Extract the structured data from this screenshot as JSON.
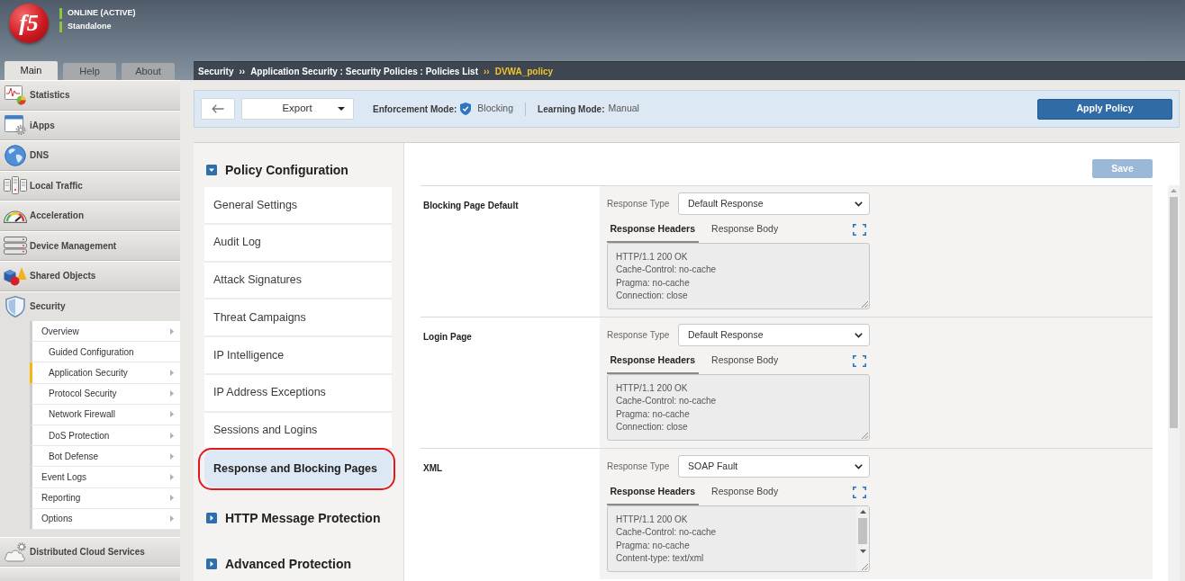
{
  "header": {
    "logo": "f5",
    "status": [
      "ONLINE (ACTIVE)",
      "Standalone"
    ]
  },
  "top_tabs": [
    {
      "label": "Main",
      "selected": true
    },
    {
      "label": "Help",
      "selected": false
    },
    {
      "label": "About",
      "selected": false
    }
  ],
  "breadcrumb": [
    {
      "label": "Security",
      "current": false
    },
    {
      "separator": "››",
      "label": "Application Security : Security Policies : Policies List",
      "current": false
    },
    {
      "separator": "››",
      "label": "DVWA_policy",
      "current": true
    }
  ],
  "sidebar": {
    "items": [
      {
        "label": "Statistics",
        "expanded": false
      },
      {
        "label": "iApps",
        "expanded": false
      },
      {
        "label": "DNS",
        "expanded": false
      },
      {
        "label": "Local Traffic",
        "expanded": false
      },
      {
        "label": "Acceleration",
        "expanded": false
      },
      {
        "label": "Device Management",
        "expanded": false
      },
      {
        "label": "Shared Objects",
        "expanded": false
      },
      {
        "label": "Security",
        "expanded": true,
        "children": [
          {
            "label": "Overview",
            "selected": false,
            "has_submenu": true,
            "children": [
              {
                "label": "Guided Configuration",
                "selected": false,
                "has_submenu": false
              },
              {
                "label": "Application Security",
                "selected": true,
                "has_submenu": true
              },
              {
                "label": "Protocol Security",
                "selected": false,
                "has_submenu": true
              },
              {
                "label": "Network Firewall",
                "selected": false,
                "has_submenu": true
              },
              {
                "label": "DoS Protection",
                "selected": false,
                "has_submenu": true
              },
              {
                "label": "Bot Defense",
                "selected": false,
                "has_submenu": true
              }
            ]
          },
          {
            "label": "Event Logs",
            "selected": false,
            "has_submenu": true
          },
          {
            "label": "Reporting",
            "selected": false,
            "has_submenu": true
          },
          {
            "label": "Options",
            "selected": false,
            "has_submenu": true
          }
        ]
      },
      {
        "label": "Distributed Cloud Services",
        "expanded": false
      }
    ]
  },
  "toolbar": {
    "export": "Export",
    "enforcement_mode": {
      "label": "Enforcement Mode:",
      "value": "Blocking"
    },
    "learning_mode": {
      "label": "Learning Mode:",
      "value": "Manual"
    },
    "apply": "Apply Policy"
  },
  "policy_nav": [
    {
      "label": "Policy Configuration",
      "expanded": true,
      "items": [
        {
          "label": "General Settings",
          "selected": false,
          "circled": false
        },
        {
          "label": "Audit Log",
          "selected": false,
          "circled": false
        },
        {
          "label": "Attack Signatures",
          "selected": false,
          "circled": false
        },
        {
          "label": "Threat Campaigns",
          "selected": false,
          "circled": false
        },
        {
          "label": "IP Intelligence",
          "selected": false,
          "circled": false
        },
        {
          "label": "IP Address Exceptions",
          "selected": false,
          "circled": false
        },
        {
          "label": "Sessions and Logins",
          "selected": false,
          "circled": false
        },
        {
          "label": "Response and Blocking Pages",
          "selected": true,
          "circled": true
        }
      ]
    },
    {
      "label": "HTTP Message Protection",
      "expanded": false
    },
    {
      "label": "Advanced Protection",
      "expanded": false
    }
  ],
  "save_button": {
    "label": "Save",
    "disabled": true
  },
  "pages": [
    {
      "name": "Blocking Page Default",
      "response_type_label": "Response Type",
      "response_type": "Default Response",
      "tabs": [
        {
          "label": "Response Headers",
          "selected": true
        },
        {
          "label": "Response Body",
          "selected": false
        }
      ],
      "headers": [
        "HTTP/1.1 200 OK",
        "Cache-Control: no-cache",
        "Pragma: no-cache",
        "Connection: close"
      ],
      "has_scrollbar": false
    },
    {
      "name": "Login Page",
      "response_type_label": "Response Type",
      "response_type": "Default Response",
      "tabs": [
        {
          "label": "Response Headers",
          "selected": true
        },
        {
          "label": "Response Body",
          "selected": false
        }
      ],
      "headers": [
        "HTTP/1.1 200 OK",
        "Cache-Control: no-cache",
        "Pragma: no-cache",
        "Connection: close"
      ],
      "has_scrollbar": false
    },
    {
      "name": "XML",
      "response_type_label": "Response Type",
      "response_type": "SOAP Fault",
      "tabs": [
        {
          "label": "Response Headers",
          "selected": true
        },
        {
          "label": "Response Body",
          "selected": false
        }
      ],
      "headers": [
        "HTTP/1.1 200 OK",
        "Cache-Control: no-cache",
        "Pragma: no-cache",
        "Content-type: text/xml"
      ],
      "has_scrollbar": true
    }
  ]
}
